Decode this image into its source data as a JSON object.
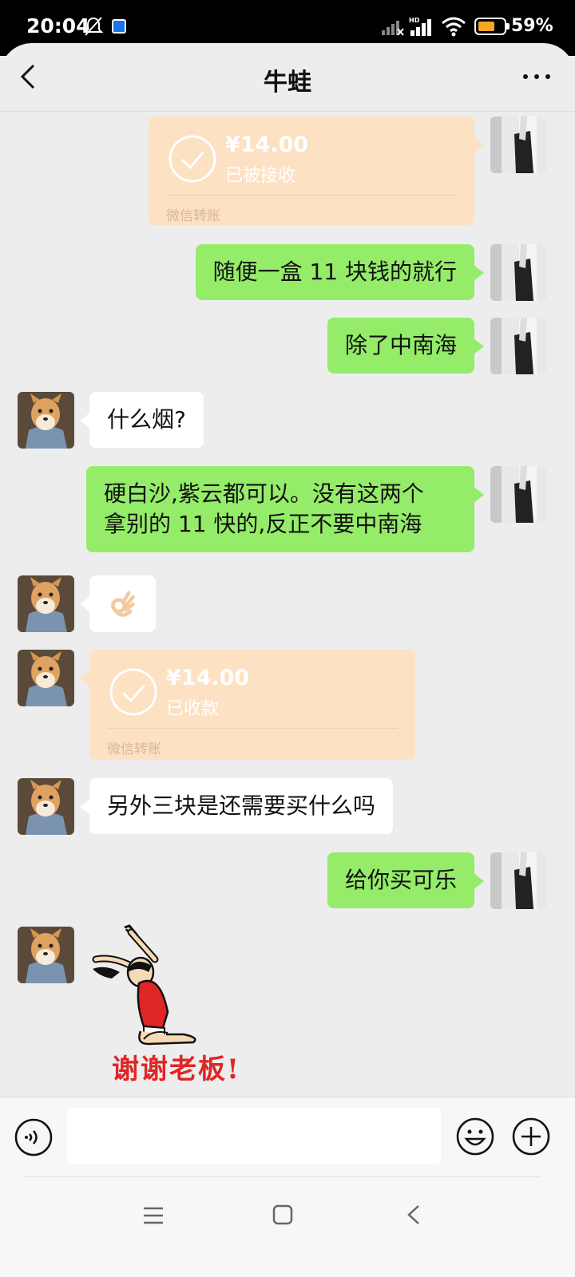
{
  "status_bar": {
    "time": "20:04",
    "battery": "59%",
    "icons": [
      "mute-bell-icon",
      "app-notification-icon",
      "signal-icon",
      "hd-signal-icon",
      "wifi-icon",
      "battery-icon"
    ]
  },
  "header": {
    "title": "牛蛙",
    "back_icon": "chevron-left-icon",
    "more_icon": "more-dots-icon"
  },
  "messages": [
    {
      "side": "right",
      "type": "transfer",
      "amount": "¥14.00",
      "status": "已被接收",
      "label": "微信转账"
    },
    {
      "side": "right",
      "type": "text",
      "text": "随便一盒 11 块钱的就行"
    },
    {
      "side": "right",
      "type": "text",
      "text": "除了中南海"
    },
    {
      "side": "left",
      "type": "text",
      "text": "什么烟?"
    },
    {
      "side": "right",
      "type": "text",
      "lines": [
        "硬白沙,紫云都可以。没有这两个",
        "拿别的 11 快的,反正不要中南海"
      ]
    },
    {
      "side": "left",
      "type": "emoji",
      "icon": "ok-hand-icon"
    },
    {
      "side": "left",
      "type": "transfer",
      "amount": "¥14.00",
      "status": "已收款",
      "label": "微信转账"
    },
    {
      "side": "left",
      "type": "text",
      "text": "另外三块是还需要买什么吗"
    },
    {
      "side": "right",
      "type": "text",
      "text": "给你买可乐"
    },
    {
      "side": "left",
      "type": "sticker",
      "caption": "谢谢老板!"
    }
  ],
  "input_bar": {
    "voice_icon": "voice-icon",
    "placeholder": "",
    "emoji_icon": "emoji-icon",
    "plus_icon": "plus-icon"
  },
  "nav_bar": {
    "icons": [
      "menu-icon",
      "home-icon",
      "back-icon"
    ]
  },
  "colors": {
    "sent_bubble": "#95ec69",
    "received_bubble": "#ffffff",
    "transfer_bubble": "#fde1c3",
    "background": "#ededed",
    "sticker_text": "#e02525"
  }
}
